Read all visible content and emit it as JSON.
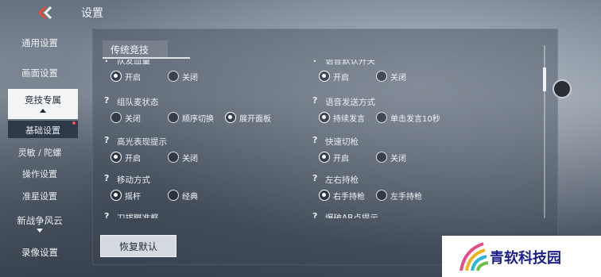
{
  "header": {
    "title": "设置",
    "back_icon": "double-chevron-left-icon",
    "back_color": "#e8483a"
  },
  "sidebar": {
    "items": [
      {
        "label": "通用设置"
      },
      {
        "label": "画面设置"
      },
      {
        "label": "竞技专属",
        "active": true
      },
      {
        "label": "基础设置",
        "sub": true,
        "selected": true,
        "badge": "red-dot"
      },
      {
        "label": "灵敏 / 陀螺",
        "sub": true
      },
      {
        "label": "操作设置",
        "sub": true
      },
      {
        "label": "准星设置",
        "sub": true
      },
      {
        "label": "新战争风云"
      },
      {
        "label": "录像设置"
      }
    ]
  },
  "panel": {
    "section_title": "传统竞技",
    "left": [
      {
        "label": "队友血量",
        "options": [
          "开启",
          "关闭"
        ],
        "selected": 0,
        "partial": true
      },
      {
        "label": "组队麦状态",
        "options": [
          "关闭",
          "顺序切换",
          "展开面板"
        ],
        "selected": 2
      },
      {
        "label": "高光表现提示",
        "options": [
          "开启",
          "关闭"
        ],
        "selected": 0
      },
      {
        "label": "移动方式",
        "options": [
          "摇杆",
          "经典"
        ],
        "selected": 0
      },
      {
        "label": "刀拔瞄准框",
        "options": [],
        "partial": true
      }
    ],
    "right": [
      {
        "label": "语音默认开关",
        "options": [
          "开启",
          "关闭"
        ],
        "selected": 0,
        "partial": true
      },
      {
        "label": "语音发送方式",
        "options": [
          "持续发言",
          "单击发言10秒"
        ],
        "selected": 0
      },
      {
        "label": "快速切枪",
        "options": [
          "开启",
          "关闭"
        ],
        "selected": 0
      },
      {
        "label": "左右持枪",
        "options": [
          "右手持枪",
          "左手持枪"
        ],
        "selected": 0
      },
      {
        "label": "爆破AB点提示",
        "options": [],
        "partial": true
      }
    ],
    "restore_label": "恢复默认"
  },
  "watermark": {
    "text": "青软科技园",
    "logo_icon": "rainbow-wave-logo-icon"
  }
}
